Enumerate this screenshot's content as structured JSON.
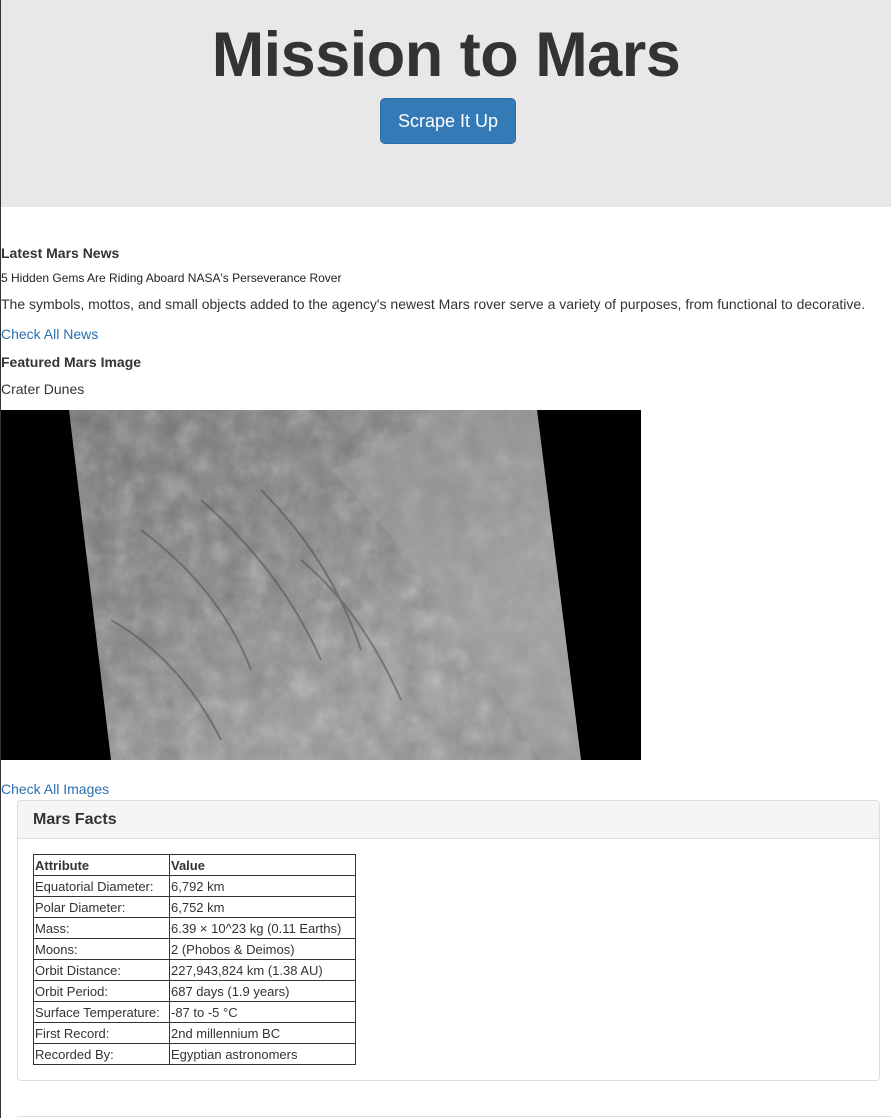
{
  "header": {
    "title": "Mission to Mars",
    "scrape_button": "Scrape It Up"
  },
  "news": {
    "heading": "Latest Mars News",
    "title": "5 Hidden Gems Are Riding Aboard NASA's Perseverance Rover",
    "body": "The symbols, mottos, and small objects added to the agency's newest Mars rover serve a variety of purposes, from functional to decorative.",
    "link": "Check All News"
  },
  "featured_image": {
    "heading": "Featured Mars Image",
    "title": "Crater Dunes",
    "link": "Check All Images"
  },
  "facts": {
    "heading": "Mars Facts",
    "columns": [
      "Attribute",
      "Value"
    ],
    "rows": [
      [
        "Equatorial Diameter:",
        "6,792 km"
      ],
      [
        "Polar Diameter:",
        "6,752 km"
      ],
      [
        "Mass:",
        "6.39 × 10^23 kg (0.11 Earths)"
      ],
      [
        "Moons:",
        "2 (Phobos & Deimos)"
      ],
      [
        "Orbit Distance:",
        "227,943,824 km (1.38 AU)"
      ],
      [
        "Orbit Period:",
        "687 days (1.9 years)"
      ],
      [
        "Surface Temperature:",
        "-87 to -5 °C"
      ],
      [
        "First Record:",
        "2nd millennium BC"
      ],
      [
        "Recorded By:",
        "Egyptian astronomers"
      ]
    ]
  },
  "colors": {
    "jumbotron_bg": "#e8e8e8",
    "button_bg": "#337ab7",
    "link": "#2a6fb0"
  }
}
